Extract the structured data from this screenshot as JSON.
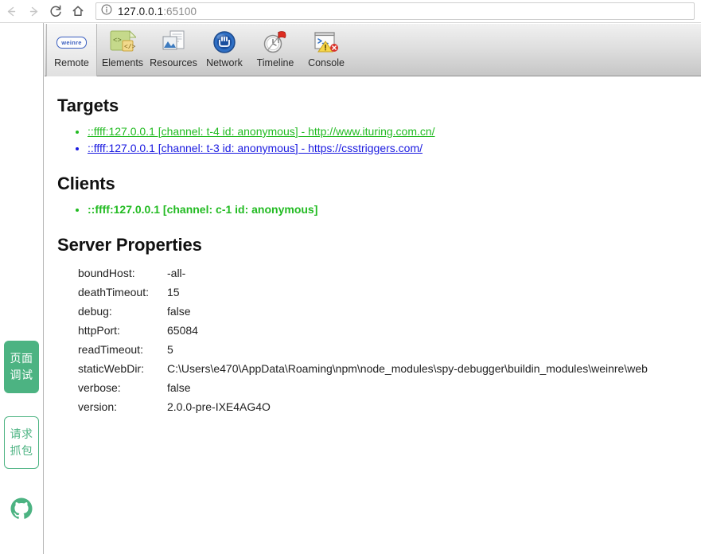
{
  "browser": {
    "back_icon": "arrow-left-icon",
    "forward_icon": "arrow-right-icon",
    "reload_icon": "reload-icon",
    "home_icon": "home-icon",
    "info_icon": "info-circle-icon",
    "url_host": "127.0.0.1",
    "url_port": ":65100",
    "url_full": "127.0.0.1:65100"
  },
  "sidebar": {
    "page_debug_label": "页面\n调试",
    "page_debug_line1": "页面",
    "page_debug_line2": "调试",
    "request_capture_line1": "请求",
    "request_capture_line2": "抓包",
    "github_icon": "github-icon",
    "active_color": "#4cb382"
  },
  "toolbar": {
    "tabs": [
      {
        "label": "Remote",
        "icon": "weinre-badge-icon",
        "selected": true
      },
      {
        "label": "Elements",
        "icon": "elements-code-icon",
        "selected": false
      },
      {
        "label": "Resources",
        "icon": "resources-documents-icon",
        "selected": false
      },
      {
        "label": "Network",
        "icon": "network-globe-icon",
        "selected": false
      },
      {
        "label": "Timeline",
        "icon": "timeline-stopwatch-flag-icon",
        "selected": false
      },
      {
        "label": "Console",
        "icon": "console-warning-icon",
        "selected": false
      }
    ],
    "weinre_badge_text": "weinre"
  },
  "main": {
    "targets": {
      "title": "Targets",
      "items": [
        {
          "text": "::ffff:127.0.0.1 [channel: t-4 id: anonymous] - http://www.ituring.com.cn/",
          "color": "#22bb22"
        },
        {
          "text": "::ffff:127.0.0.1 [channel: t-3 id: anonymous] - https://csstriggers.com/",
          "color": "#1a1ae0"
        }
      ]
    },
    "clients": {
      "title": "Clients",
      "items": [
        {
          "text": "::ffff:127.0.0.1 [channel: c-1 id: anonymous]",
          "color": "#22bb22"
        }
      ]
    },
    "server_properties": {
      "title": "Server Properties",
      "rows": [
        {
          "name": "boundHost:",
          "value": "-all-"
        },
        {
          "name": "deathTimeout:",
          "value": "15"
        },
        {
          "name": "debug:",
          "value": "false"
        },
        {
          "name": "httpPort:",
          "value": "65084"
        },
        {
          "name": "readTimeout:",
          "value": "5"
        },
        {
          "name": "staticWebDir:",
          "value": "C:\\Users\\e470\\AppData\\Roaming\\npm\\node_modules\\spy-debugger\\buildin_modules\\weinre\\web"
        },
        {
          "name": "verbose:",
          "value": "false"
        },
        {
          "name": "version:",
          "value": "2.0.0-pre-IXE4AG4O"
        }
      ]
    }
  }
}
